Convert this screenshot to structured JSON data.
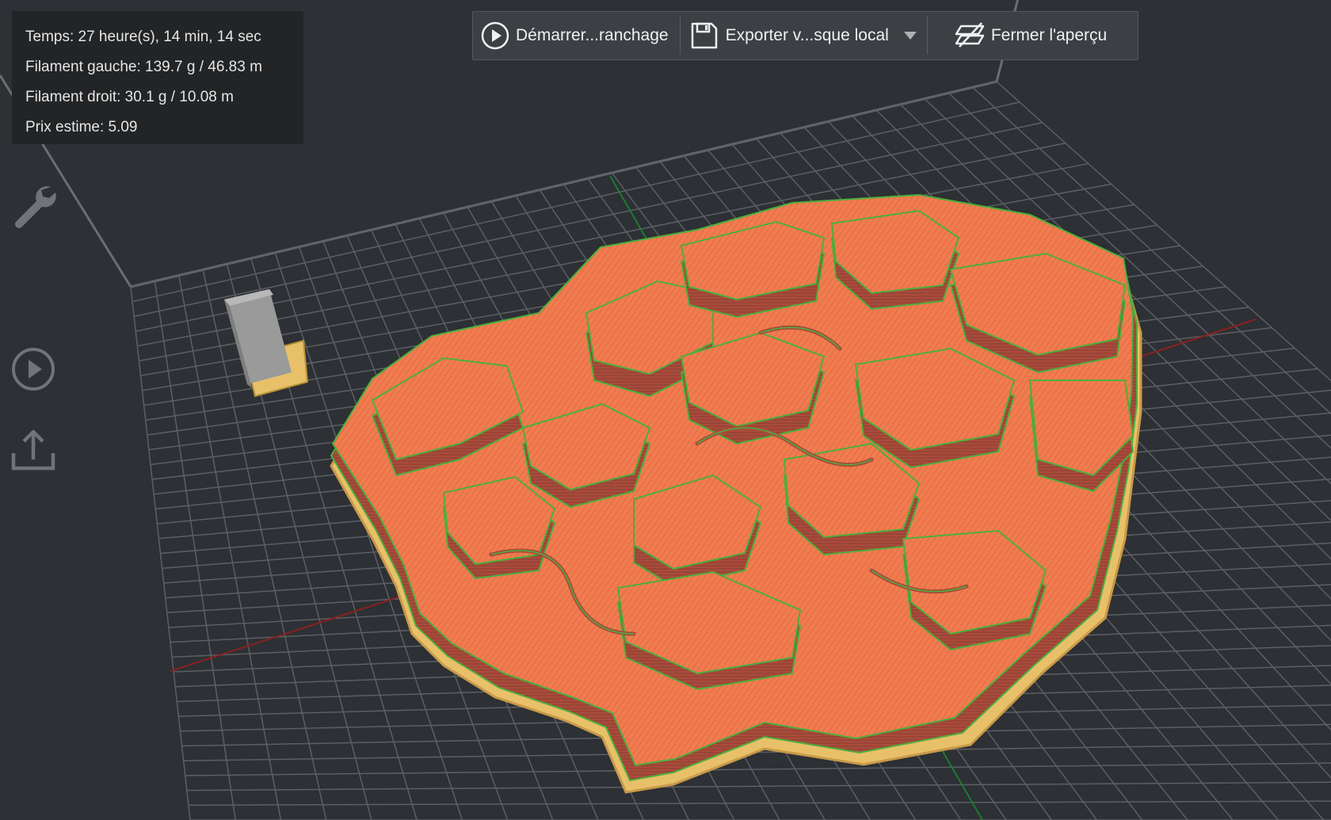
{
  "stats": {
    "time": "Temps: 27 heure(s), 14 min, 14 sec",
    "filament_left": "Filament gauche: 139.7 g / 46.83 m",
    "filament_right": "Filament droit: 30.1 g / 10.08 m",
    "price": "Prix estime: 5.09"
  },
  "toolbar": {
    "start_slicing": "Démarrer...ranchage",
    "export": "Exporter v...sque local",
    "close_preview": "Fermer l'aperçu"
  },
  "icons": {
    "settings": "wrench-icon",
    "print": "play-circle-icon",
    "upload": "upload-icon",
    "save": "floppy-disk-icon",
    "dropdown": "caret-down-icon",
    "preview": "layers-icon"
  },
  "colors": {
    "background": "#2d3034",
    "grid": "#6a6d71",
    "model_top": "#f07c50",
    "model_wall": "#a84c3c",
    "model_outline": "#4caf3c",
    "base_layer": "#e8c06a",
    "support": "#9a9a9a",
    "panel": "#222426",
    "toolbar": "#3c3f43"
  }
}
